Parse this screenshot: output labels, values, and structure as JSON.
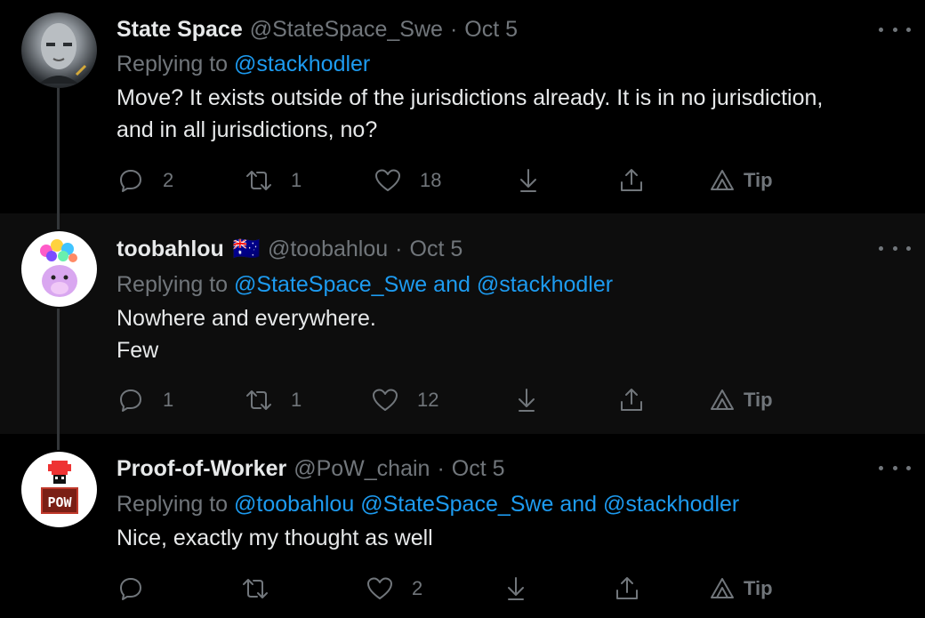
{
  "tweets": [
    {
      "name": "State Space",
      "handle": "@StateSpace_Swe",
      "dot": "·",
      "date": "Oct 5",
      "replying_prefix": "Replying to",
      "mentions": [
        "@stackhodler"
      ],
      "mention_joiner": "",
      "body_lines": [
        "Move? It exists outside of the jurisdictions already. It is in no jurisdiction,",
        "and in all jurisdictions, no?"
      ],
      "replies": "2",
      "retweets": "1",
      "likes": "18",
      "tip": "Tip"
    },
    {
      "name": "toobahlou",
      "flag": "🇦🇺",
      "handle": "@toobahlou",
      "dot": "·",
      "date": "Oct 5",
      "replying_prefix": "Replying to",
      "mention_a": "@StateSpace_Swe",
      "mention_and": "and",
      "mention_b": "@stackhodler",
      "body_lines": [
        "Nowhere and everywhere.",
        "Few"
      ],
      "replies": "1",
      "retweets": "1",
      "likes": "12",
      "tip": "Tip"
    },
    {
      "name": "Proof-of-Worker",
      "handle": "@PoW_chain",
      "dot": "·",
      "date": "Oct 5",
      "replying_prefix": "Replying to",
      "mention_a": "@toobahlou",
      "mention_b": "@StateSpace_Swe",
      "mention_and": "and",
      "mention_c": "@stackhodler",
      "body_lines": [
        "Nice, exactly my thought as well"
      ],
      "replies": "",
      "retweets": "",
      "likes": "2",
      "tip": "Tip",
      "avatar_text": "POW"
    }
  ],
  "colors": {
    "background": "#000000",
    "alt_background": "#0d0d0d",
    "text": "#e7e9ea",
    "muted": "#71767b",
    "link": "#1d9bf0"
  },
  "icons": [
    "reply-icon",
    "retweet-icon",
    "like-icon",
    "download-icon",
    "share-icon",
    "tip-icon",
    "more-icon"
  ]
}
